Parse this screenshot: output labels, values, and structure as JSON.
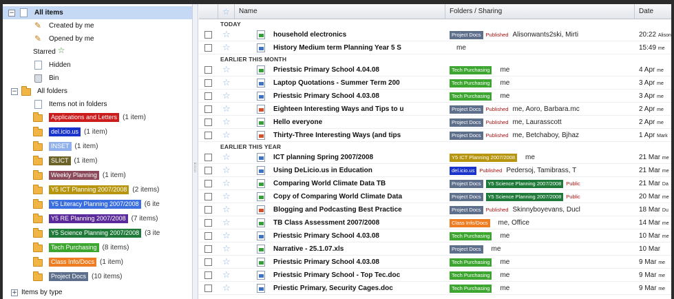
{
  "sidebar": {
    "all_items": "All items",
    "created_by_me": "Created by me",
    "opened_by_me": "Opened by me",
    "starred": "Starred",
    "hidden": "Hidden",
    "bin": "Bin",
    "all_folders": "All folders",
    "items_not_in_folders": "Items not in folders",
    "folders": [
      {
        "label": "Applications and Letters",
        "count": "(1 item)",
        "color": "#cc1b1b"
      },
      {
        "label": "del.icio.us",
        "count": "(1 item)",
        "color": "#1a33cc"
      },
      {
        "label": "INSET",
        "count": "(1 item)",
        "color": "#8fb0ea"
      },
      {
        "label": "SLICT",
        "count": "(1 item)",
        "color": "#6b6327"
      },
      {
        "label": "Weekly Planning",
        "count": "(1 item)",
        "color": "#8a4a5a"
      },
      {
        "label": "Y5 ICT Planning 2007/2008",
        "count": "(2 items)",
        "color": "#b8950e"
      },
      {
        "label": "Y5 Literacy Planning 2007/2008",
        "count": "(6 ite",
        "color": "#3b6fe0"
      },
      {
        "label": "Y5 RE Planning 2007/2008",
        "count": "(7 items)",
        "color": "#5a2a9a"
      },
      {
        "label": "Y5 Science Planning 2007/2008",
        "count": "(3 ite",
        "color": "#1f7a3a"
      },
      {
        "label": "Tech Purchasing",
        "count": "(8 items)",
        "color": "#3da630"
      },
      {
        "label": "Class Info/Docs",
        "count": "(1 item)",
        "color": "#ee7d22"
      },
      {
        "label": "Project Docs",
        "count": "(10 items)",
        "color": "#5e6f8c"
      }
    ],
    "items_by_type": "Items by type"
  },
  "table": {
    "col_name": "Name",
    "col_folders": "Folders / Sharing",
    "col_date": "Date"
  },
  "sections": {
    "today": "TODAY",
    "earlier_month": "EARLIER THIS MONTH",
    "earlier_year": "EARLIER THIS YEAR"
  },
  "rows": [
    {
      "name": "household electronics",
      "type": "sheet",
      "tags": [
        {
          "label": "Project Docs",
          "color": "#5e6f8c"
        }
      ],
      "published": "Published",
      "share": "Alisonwants2ski, Mirti",
      "date": "20:22",
      "date_by": "Alison"
    },
    {
      "name": "History Medium term Planning Year 5 S",
      "type": "doc",
      "tags": [],
      "published": "",
      "share": "me",
      "date": "15:49",
      "date_by": "me"
    },
    {
      "name": "Priestsic Primary School 4.04.08",
      "type": "sheet",
      "tags": [
        {
          "label": "Tech Purchasing",
          "color": "#3da630"
        }
      ],
      "published": "",
      "share": "me",
      "date": "4 Apr",
      "date_by": "me"
    },
    {
      "name": "Laptop Quotations - Summer Term 200",
      "type": "doc",
      "tags": [
        {
          "label": "Tech Purchasing",
          "color": "#3da630"
        }
      ],
      "published": "",
      "share": "me",
      "date": "3 Apr",
      "date_by": "me"
    },
    {
      "name": "Priestsic Primary School 4.03.08",
      "type": "doc",
      "tags": [
        {
          "label": "Tech Purchasing",
          "color": "#3da630"
        }
      ],
      "published": "",
      "share": "me",
      "date": "3 Apr",
      "date_by": "me"
    },
    {
      "name": "Eighteen Interesting Ways and Tips to u",
      "type": "pres",
      "tags": [
        {
          "label": "Project Docs",
          "color": "#5e6f8c"
        }
      ],
      "published": "Published",
      "share": "me, Aoro, Barbara.mc",
      "date": "2 Apr",
      "date_by": "me"
    },
    {
      "name": "Hello everyone",
      "type": "sheet",
      "tags": [
        {
          "label": "Project Docs",
          "color": "#5e6f8c"
        }
      ],
      "published": "Published",
      "share": "me, Laurasscott",
      "date": "2 Apr",
      "date_by": "me"
    },
    {
      "name": "Thirty-Three Interesting Ways (and tips",
      "type": "pres",
      "tags": [
        {
          "label": "Project Docs",
          "color": "#5e6f8c"
        }
      ],
      "published": "Published",
      "share": "me, Betchaboy, Bjhaz",
      "date": "1 Apr",
      "date_by": "Mark"
    },
    {
      "name": "ICT planning Spring 2007/2008",
      "type": "doc",
      "tags": [
        {
          "label": "Y5 ICT Planning 2007/2008",
          "color": "#b8950e"
        }
      ],
      "published": "",
      "share": "me",
      "date": "21 Mar",
      "date_by": "me"
    },
    {
      "name": "Using DeLicio.us in Education",
      "type": "doc",
      "tags": [
        {
          "label": "del.icio.us",
          "color": "#1a33cc"
        }
      ],
      "published": "Published",
      "share": "Pedersoj, Tamibrass, T",
      "date": "21 Mar",
      "date_by": "me"
    },
    {
      "name": "Comparing World Climate Data TB",
      "type": "sheet",
      "tags": [
        {
          "label": "Project Docs",
          "color": "#5e6f8c"
        },
        {
          "label": "Y5 Science Planning 2007/2008",
          "color": "#1f7a3a"
        }
      ],
      "published": "Public",
      "share": "",
      "date": "21 Mar",
      "date_by": "Da"
    },
    {
      "name": "Copy of Comparing World Climate Data",
      "type": "sheet",
      "tags": [
        {
          "label": "Project Docs",
          "color": "#5e6f8c"
        },
        {
          "label": "Y5 Science Planning 2007/2008",
          "color": "#1f7a3a"
        }
      ],
      "published": "Public",
      "share": "",
      "date": "20 Mar",
      "date_by": "me"
    },
    {
      "name": "Blogging and Podcasting Best Practice",
      "type": "pres",
      "tags": [
        {
          "label": "Project Docs",
          "color": "#5e6f8c"
        }
      ],
      "published": "Published",
      "share": "Skinnyboyevans, Ducl",
      "date": "18 Mar",
      "date_by": "Du"
    },
    {
      "name": "TB Class Assessment 2007/2008",
      "type": "sheet",
      "tags": [
        {
          "label": "Class Info/Docs",
          "color": "#ee7d22"
        }
      ],
      "published": "",
      "share": "me, Office",
      "date": "14 Mar",
      "date_by": "me"
    },
    {
      "name": "Priestsic Primary School 4.03.08",
      "type": "doc",
      "tags": [
        {
          "label": "Tech Purchasing",
          "color": "#3da630"
        }
      ],
      "published": "",
      "share": "me",
      "date": "10 Mar",
      "date_by": "me"
    },
    {
      "name": "Narrative - 25.1.07.xls",
      "type": "sheet",
      "tags": [
        {
          "label": "Project Docs",
          "color": "#5e6f8c"
        }
      ],
      "published": "",
      "share": "me",
      "date": "10 Mar",
      "date_by": ""
    },
    {
      "name": "Priestsic Primary School 4.03.08",
      "type": "sheet",
      "tags": [
        {
          "label": "Tech Purchasing",
          "color": "#3da630"
        }
      ],
      "published": "",
      "share": "me",
      "date": "9 Mar",
      "date_by": "me"
    },
    {
      "name": "Priestsic Primary School - Top Tec.doc",
      "type": "doc",
      "tags": [
        {
          "label": "Tech Purchasing",
          "color": "#3da630"
        }
      ],
      "published": "",
      "share": "me",
      "date": "9 Mar",
      "date_by": "me"
    },
    {
      "name": "Priestic Primary, Security Cages.doc",
      "type": "doc",
      "tags": [
        {
          "label": "Tech Purchasing",
          "color": "#3da630"
        }
      ],
      "published": "",
      "share": "me",
      "date": "9 Mar",
      "date_by": "me"
    }
  ]
}
